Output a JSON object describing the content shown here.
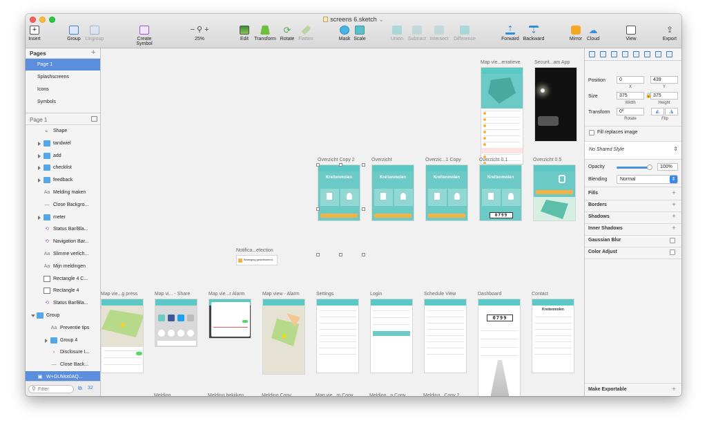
{
  "window": {
    "title": "screens 6.sketch"
  },
  "toolbar": {
    "insert": "Insert",
    "group": "Group",
    "ungroup": "Ungroup",
    "create_symbol": "Create Symbol",
    "zoom": "25%",
    "edit": "Edit",
    "transform": "Transform",
    "rotate": "Rotate",
    "flatten": "Flatten",
    "mask": "Mask",
    "scale": "Scale",
    "union": "Union",
    "subtract": "Subtract",
    "intersect": "Intersect",
    "difference": "Difference",
    "forward": "Forward",
    "backward": "Backward",
    "mirror": "Mirror",
    "cloud": "Cloud",
    "view": "View",
    "export": "Export",
    "zoom_minus": "−",
    "zoom_plus": "+"
  },
  "pages": {
    "header": "Pages",
    "add": "+",
    "items": [
      "Page 1",
      "Splashscreens",
      "Icons",
      "Symbols"
    ],
    "selected": 0
  },
  "layers": {
    "header": "Page 1",
    "items": [
      {
        "name": "Shape",
        "icon": "shape-icon"
      },
      {
        "name": "tandwiel",
        "icon": "folder-icon"
      },
      {
        "name": "add",
        "icon": "folder-icon"
      },
      {
        "name": "checklist",
        "icon": "folder-icon"
      },
      {
        "name": "feedback",
        "icon": "folder-icon"
      },
      {
        "name": "Melding maken",
        "icon": "text-icon"
      },
      {
        "name": "Close Backgro...",
        "icon": "line-icon"
      },
      {
        "name": "meter",
        "icon": "folder-icon"
      },
      {
        "name": "Status Bar/Bla...",
        "icon": "symbol-icon"
      },
      {
        "name": "Navigation Bar...",
        "icon": "symbol-icon"
      },
      {
        "name": "Slimme verlich...",
        "icon": "text-icon"
      },
      {
        "name": "Mijn meldingen",
        "icon": "text-icon"
      },
      {
        "name": "Rectangle 4 C...",
        "icon": "rect-icon"
      },
      {
        "name": "Rectangle 4",
        "icon": "rect-icon"
      },
      {
        "name": "Status Bar/Bla...",
        "icon": "symbol-icon"
      },
      {
        "name": "Group",
        "icon": "folder-icon"
      },
      {
        "name": "Preventie tips",
        "icon": "text-icon"
      },
      {
        "name": "Group 4",
        "icon": "folder-icon"
      },
      {
        "name": "Disclosure I...",
        "icon": "chevron-icon"
      },
      {
        "name": "Close Back...",
        "icon": "line-icon"
      },
      {
        "name": "W+GUMot0AQ...",
        "icon": "image-icon"
      }
    ],
    "filter_placeholder": "Filter",
    "count": "32"
  },
  "artboards": [
    {
      "label": "Map vie...erratieve",
      "kind": "map"
    },
    {
      "label": "Securit...am App",
      "kind": "photo"
    },
    {
      "label": "Overzicht Copy 2",
      "kind": "home"
    },
    {
      "label": "Overzicht",
      "kind": "home"
    },
    {
      "label": "Overzic...1 Copy",
      "kind": "home"
    },
    {
      "label": "Overzicht 0.1",
      "kind": "meter"
    },
    {
      "label": "Overzicht 0.5",
      "kind": "homemap"
    },
    {
      "label": "Notifica...etection",
      "kind": "notification"
    },
    {
      "label": "Map vie...g press",
      "kind": "mapgreen"
    },
    {
      "label": "Map vi... - Share",
      "kind": "share"
    },
    {
      "label": "Map vie...r Alarm",
      "kind": "alarm"
    },
    {
      "label": "Map view - Alarm",
      "kind": "mapalarm"
    },
    {
      "label": "Settings",
      "kind": "list"
    },
    {
      "label": "Login",
      "kind": "login"
    },
    {
      "label": "Schedule View",
      "kind": "list"
    },
    {
      "label": "Dashboard",
      "kind": "dashboard"
    },
    {
      "label": "Contact",
      "kind": "contact"
    },
    {
      "label": "Melding",
      "kind": "stub"
    },
    {
      "label": "Melding bekijken",
      "kind": "stub"
    },
    {
      "label": "Melding Copy",
      "kind": "stub"
    },
    {
      "label": "Map vie...m Copy",
      "kind": "stub"
    },
    {
      "label": "Melding...n Copy",
      "kind": "stub"
    },
    {
      "label": "Melding...Copy 2",
      "kind": "stub"
    }
  ],
  "texts": {
    "brand": "Kreitenmolen",
    "meter": "0799",
    "contact_title": "Kreitenmolen",
    "notification_text": "Beweging gedetecteerd"
  },
  "inspector": {
    "position_label": "Position",
    "x": "0",
    "y": "439",
    "x_label": "X",
    "y_label": "Y",
    "size_label": "Size",
    "width": "375",
    "height": "375",
    "w_label": "Width",
    "h_label": "Height",
    "transform_label": "Transform",
    "rotate_value": "0º",
    "rotate_label": "Rotate",
    "flip_label": "Flip",
    "fill_replaces": "Fill replaces image",
    "style": "No Shared Style",
    "opacity_label": "Opacity",
    "opacity_value": "100%",
    "opacity": 1.0,
    "blending_label": "Blending",
    "blending_value": "Normal",
    "sections": [
      "Fills",
      "Borders",
      "Shadows",
      "Inner Shadows",
      "Gaussian Blur",
      "Color Adjust"
    ],
    "make_exportable": "Make Exportable"
  },
  "colors": {
    "accent": "#5b8fde",
    "teal": "#5ac9c5",
    "orange": "#f3b245"
  }
}
